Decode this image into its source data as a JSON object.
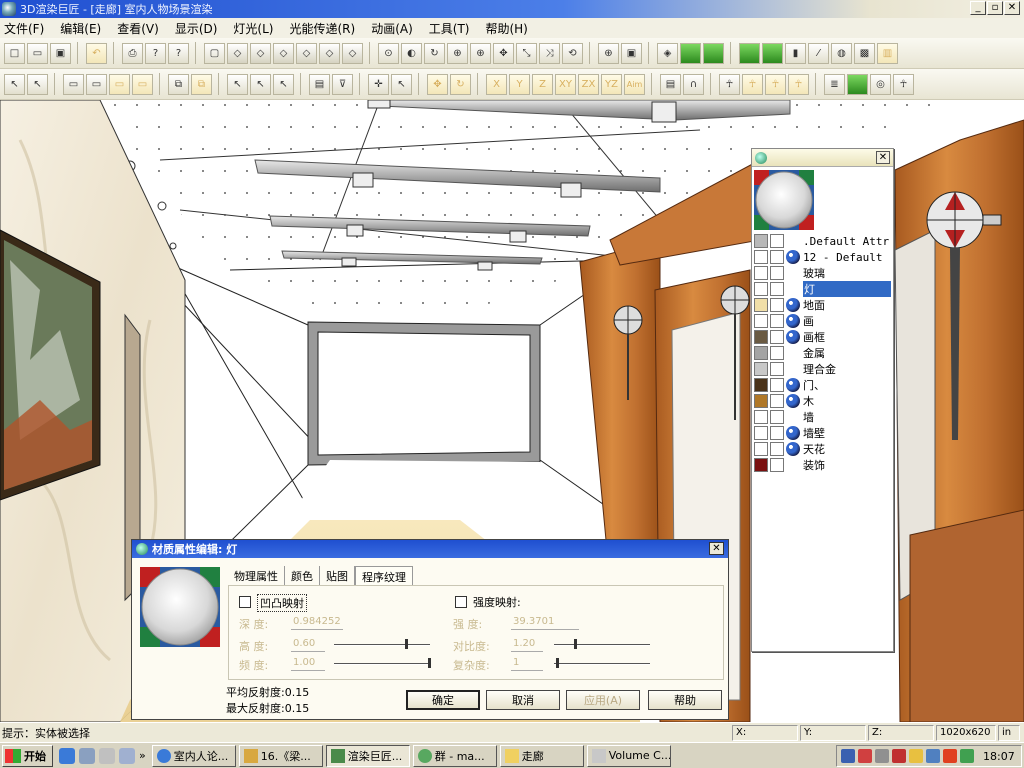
{
  "window": {
    "title": "3D渲染巨匠 - [走廊] 室内人物场景渲染",
    "controls": [
      "_",
      "▫",
      "✕"
    ]
  },
  "menu": [
    "文件(F)",
    "编辑(E)",
    "查看(V)",
    "显示(D)",
    "灯光(L)",
    "光能传递(R)",
    "动画(A)",
    "工具(T)",
    "帮助(H)"
  ],
  "toolbar2_axes": [
    "X",
    "Y",
    "Z",
    "XY",
    "ZX",
    "YZ",
    "Aim"
  ],
  "materials_panel": {
    "close": "✕",
    "items": [
      {
        "name": ".Default Attr",
        "swatch": "#b8b8b8",
        "textured": false,
        "mono": true
      },
      {
        "name": "12 - Default",
        "swatch": "#ffffff",
        "textured": true,
        "mono": true
      },
      {
        "name": "玻璃",
        "swatch": "#ffffff",
        "textured": false
      },
      {
        "name": "灯",
        "swatch": "#ffffff",
        "textured": false,
        "selected": true
      },
      {
        "name": "地面",
        "swatch": "#f1dfa8",
        "textured": true
      },
      {
        "name": "画",
        "swatch": "#ffffff",
        "textured": true
      },
      {
        "name": "画框",
        "swatch": "#6a5a42",
        "textured": true
      },
      {
        "name": "金属",
        "swatch": "#a4a4a4",
        "textured": false
      },
      {
        "name": "理合金",
        "swatch": "#c8c8c8",
        "textured": false
      },
      {
        "name": "门、",
        "swatch": "#4a3218",
        "textured": true
      },
      {
        "name": "木",
        "swatch": "#b07828",
        "textured": true
      },
      {
        "name": "墙",
        "swatch": "#ffffff",
        "textured": false
      },
      {
        "name": "墙壁",
        "swatch": "#ffffff",
        "textured": true
      },
      {
        "name": "天花",
        "swatch": "#ffffff",
        "textured": true
      },
      {
        "name": "装饰",
        "swatch": "#7a1010",
        "textured": false
      }
    ]
  },
  "dialog": {
    "title": "材质属性编辑: 灯",
    "close": "✕",
    "tabs": [
      "物理属性",
      "颜色",
      "贴图",
      "程序纹理"
    ],
    "bump": {
      "label": "凹凸映射",
      "depth_label": "深  度:",
      "depth_value": "0.984252",
      "height_label": "高  度:",
      "height_value": "0.60",
      "freq_label": "频  度:",
      "freq_value": "1.00"
    },
    "intensity": {
      "label": "强度映射:",
      "depth_label": "强  度:",
      "depth_value": "39.3701",
      "contrast_label": "对比度:",
      "contrast_value": "1.20",
      "complex_label": "复杂度:",
      "complex_value": "1"
    },
    "avg_reflect": "平均反射度:0.15",
    "max_reflect": "最大反射度:0.15",
    "buttons": {
      "ok": "确定",
      "cancel": "取消",
      "apply": "应用(A)",
      "help": "帮助"
    }
  },
  "statusbar": {
    "hint": "提示：实体被选择",
    "x": "X:",
    "y": "Y:",
    "z": "Z:",
    "resolution": "1020x620",
    "unit": "in"
  },
  "taskbar": {
    "start": "开始",
    "more": "»",
    "tasks": [
      {
        "label": "室内人论...",
        "active": false
      },
      {
        "label": "16.《梁...",
        "active": false
      },
      {
        "label": "渲染巨匠...",
        "active": true
      },
      {
        "label": "群 - ma...",
        "active": false
      },
      {
        "label": "走廊",
        "active": false
      },
      {
        "label": "Volume C...",
        "active": false
      }
    ],
    "clock": "18:07"
  },
  "colors": {
    "title_bar": "#1f4fd0",
    "selection": "#316ac5",
    "wood": "#c8702c",
    "floor": "#f3dfa8"
  }
}
